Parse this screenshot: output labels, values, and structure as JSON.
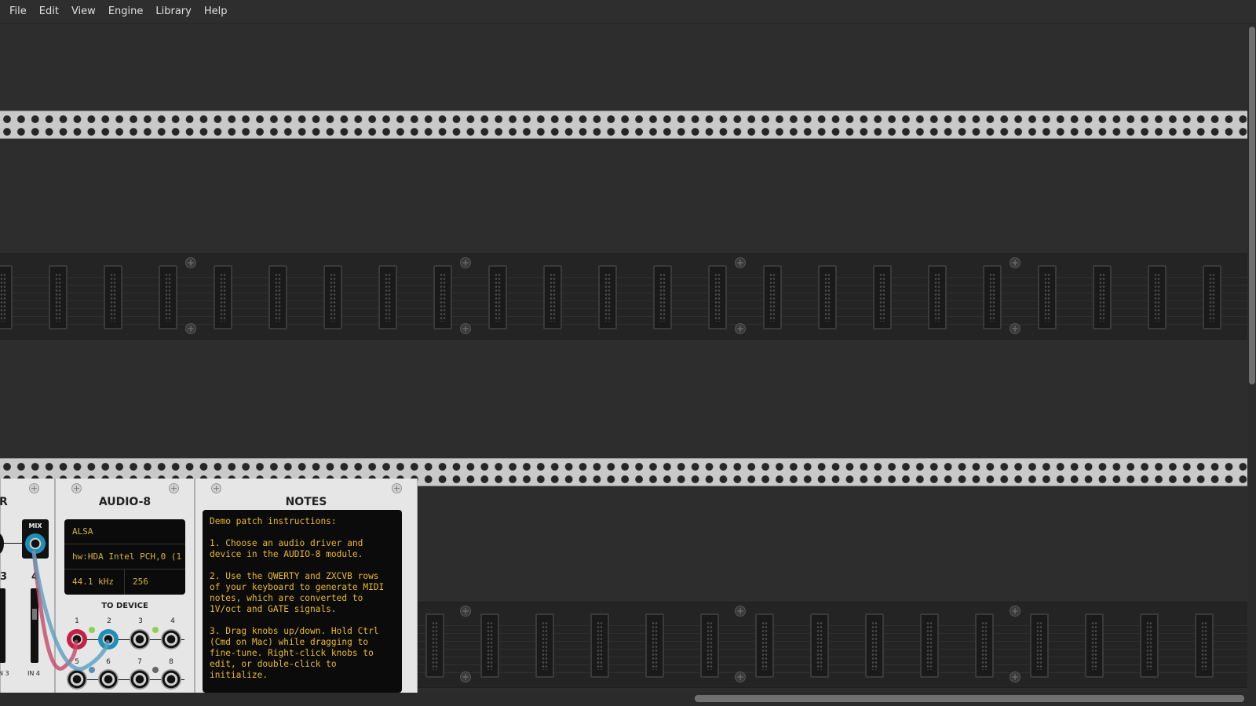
{
  "menu": [
    "File",
    "Edit",
    "View",
    "Engine",
    "Library",
    "Help"
  ],
  "mixer": {
    "mix_label": "MIX",
    "col3": "3",
    "col4": "4",
    "in3": "N 3",
    "in4": "IN 4",
    "title_fragment": "R"
  },
  "audio8": {
    "title": "AUDIO-8",
    "driver": "ALSA",
    "device": "hw:HDA Intel PCH,0 (1",
    "sample_rate": "44.1 kHz",
    "block_size": "256",
    "to_device_label": "TO DEVICE",
    "jack_numbers": [
      "1",
      "2",
      "3",
      "4",
      "5",
      "6",
      "7",
      "8"
    ]
  },
  "notes": {
    "title": "NOTES",
    "text": "Demo patch instructions:\n\n1. Choose an audio driver and\ndevice in the AUDIO-8 module.\n\n2. Use the QWERTY and ZXCVB rows\nof your keyboard to generate MIDI\nnotes, which are converted to\n1V/oct and GATE signals.\n\n3. Drag knobs up/down. Hold Ctrl\n(Cmd on Mac) while dragging to\nfine-tune. Right-click knobs to\nedit, or double-click to\ninitialize."
  },
  "colors": {
    "cable_red": "#c44a6a",
    "cable_blue": "#5a9fc0",
    "lcd_text": "#e8b92b",
    "led_green": "#8fd14f"
  }
}
